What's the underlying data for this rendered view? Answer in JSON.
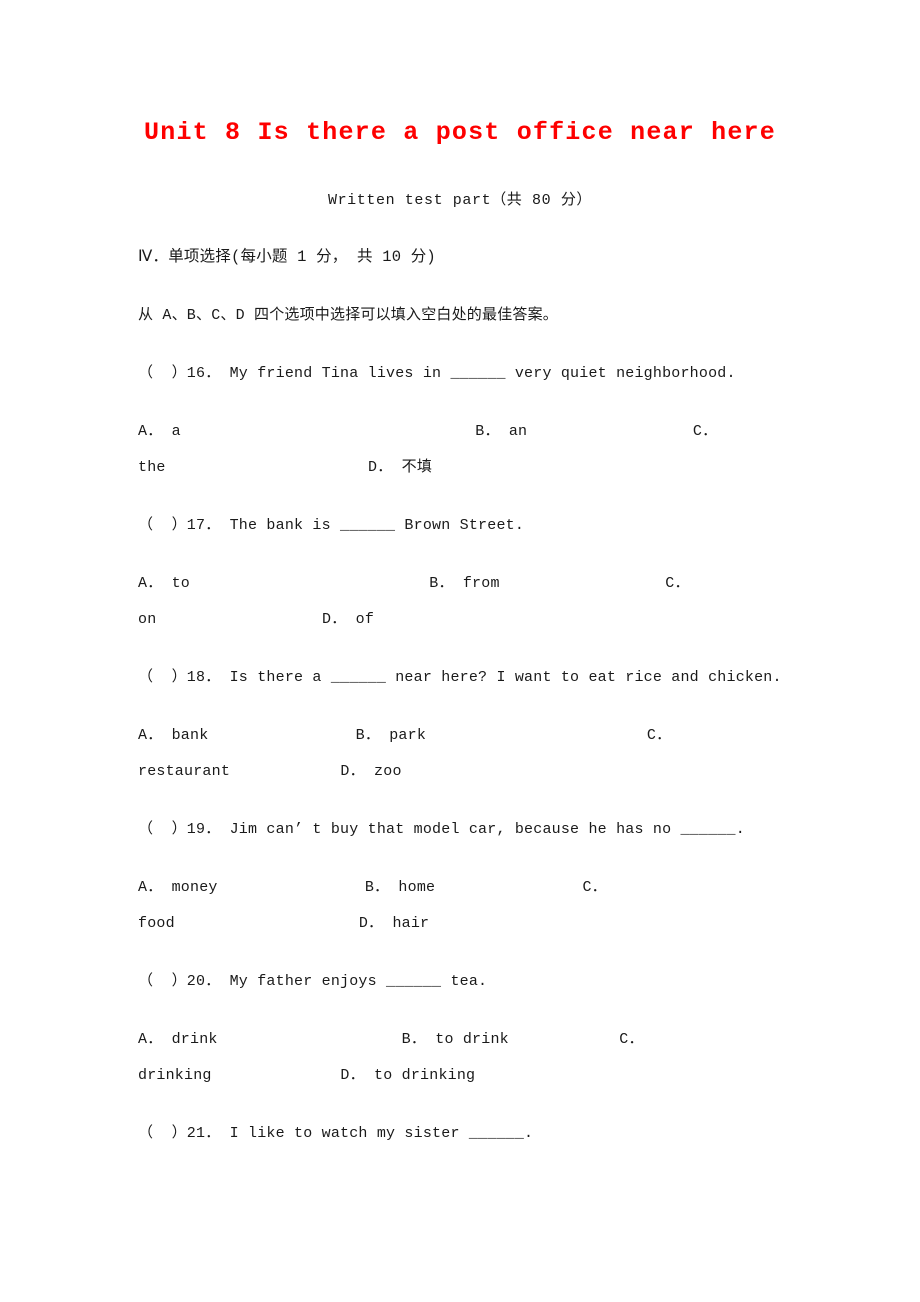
{
  "document": {
    "title": "Unit 8 Is there a post office near here",
    "subtitle": "Written test part（共 80 分）",
    "section_heading": "Ⅳ．单项选择(每小题 1 分， 共 10 分)",
    "instruction": "从 A、B、C、D 四个选项中选择可以填入空白处的最佳答案。",
    "title_color": "#fe0000",
    "body_color": "#1a1a1a",
    "page_background": "#ffffff"
  },
  "questions": [
    {
      "number": "16",
      "stem": "（  ）16． My friend Tina lives in ______ very quiet neighborhood.",
      "options_line_1": "A． a                                B． an                  C．",
      "options_line_2": "the                      D． 不填",
      "options": [
        "A． a",
        "B． an",
        "C． the",
        "D． 不填"
      ]
    },
    {
      "number": "17",
      "stem": "（  ）17． The bank is ______ Brown Street.",
      "options_line_1": "A． to                          B． from                  C．",
      "options_line_2": "on                  D． of",
      "options": [
        "A． to",
        "B． from",
        "C． on",
        "D． of"
      ]
    },
    {
      "number": "18",
      "stem": "（  ）18． Is there a ______ near here? I want to eat rice and chicken.",
      "options_line_1": "A． bank                B． park                        C．",
      "options_line_2": "restaurant            D． zoo",
      "options": [
        "A． bank",
        "B． park",
        "C． restaurant",
        "D． zoo"
      ]
    },
    {
      "number": "19",
      "stem": "（  ）19． Jim can’ t buy that model car, because he has no ______.",
      "options_line_1": "A． money                B． home                C．",
      "options_line_2": "food                    D． hair",
      "options": [
        "A． money",
        "B． home",
        "C． food",
        "D． hair"
      ]
    },
    {
      "number": "20",
      "stem": "（  ）20． My father enjoys ______ tea.",
      "options_line_1": "A． drink                    B． to drink            C．",
      "options_line_2": "drinking              D． to drinking",
      "options": [
        "A． drink",
        "B． to drink",
        "C． drinking",
        "D． to drinking"
      ]
    },
    {
      "number": "21",
      "stem": "（  ）21． I like to watch my sister ______.",
      "options_line_1": "",
      "options_line_2": "",
      "options": []
    }
  ]
}
